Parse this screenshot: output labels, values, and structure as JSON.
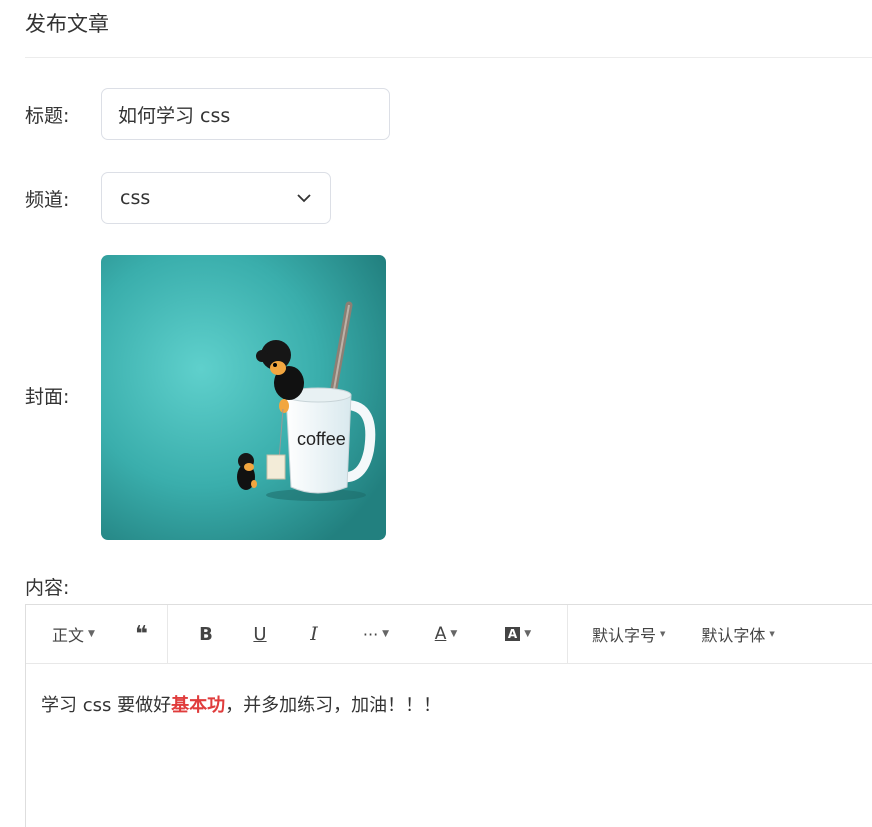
{
  "header": {
    "title": "发布文章"
  },
  "form": {
    "title_label": "标题:",
    "title_value": "如何学习 css",
    "channel_label": "频道:",
    "channel_value": "css",
    "cover_label": "封面:",
    "cover_image_text": "coffee",
    "content_label": "内容:"
  },
  "editor": {
    "toolbar": {
      "paragraph": "正文",
      "quote": "❝",
      "bold": "B",
      "underline": "U",
      "italic": "I",
      "more": "···",
      "font_color": "A",
      "bg_color": "A",
      "font_size": "默认字号",
      "font_family": "默认字体"
    },
    "content": {
      "before": "学习 css 要做好",
      "highlight": "基本功",
      "after": "，并多加练习，加油！！！"
    }
  },
  "colors": {
    "highlight": "#e03c3c",
    "cover_bg": "#3fb5b3"
  }
}
